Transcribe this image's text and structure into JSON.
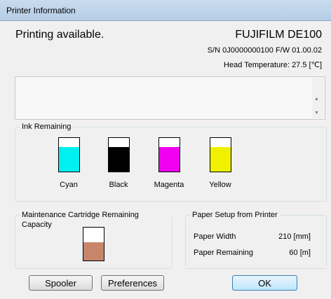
{
  "window": {
    "title": "Printer Information"
  },
  "status": {
    "text": "Printing available."
  },
  "printer": {
    "model": "FUJIFILM DE100",
    "serial_firmware": "S/N 0J0000000100  F/W 01.00.02",
    "head_temperature": "Head Temperature: 27.5 [℃]"
  },
  "message_box": {
    "scroll_up_icon": "triangle-up",
    "scroll_down_icon": "triangle-down"
  },
  "ink": {
    "legend": "Ink Remaining",
    "items": [
      {
        "label": "Cyan",
        "color": "#00f0f0",
        "level": 0.72
      },
      {
        "label": "Black",
        "color": "#000000",
        "level": 0.72
      },
      {
        "label": "Magenta",
        "color": "#f000f0",
        "level": 0.72
      },
      {
        "label": "Yellow",
        "color": "#f0f000",
        "level": 0.72
      }
    ]
  },
  "maintenance": {
    "legend": "Maintenance Cartridge Remaining Capacity",
    "color": "#c7866a",
    "level": 0.55
  },
  "paper": {
    "legend": "Paper Setup from Printer",
    "width_label": "Paper Width",
    "width_value": "210 [mm]",
    "remaining_label": "Paper Remaining",
    "remaining_value": "60 [m]"
  },
  "buttons": {
    "spooler": "Spooler",
    "preferences": "Preferences",
    "ok": "OK"
  }
}
